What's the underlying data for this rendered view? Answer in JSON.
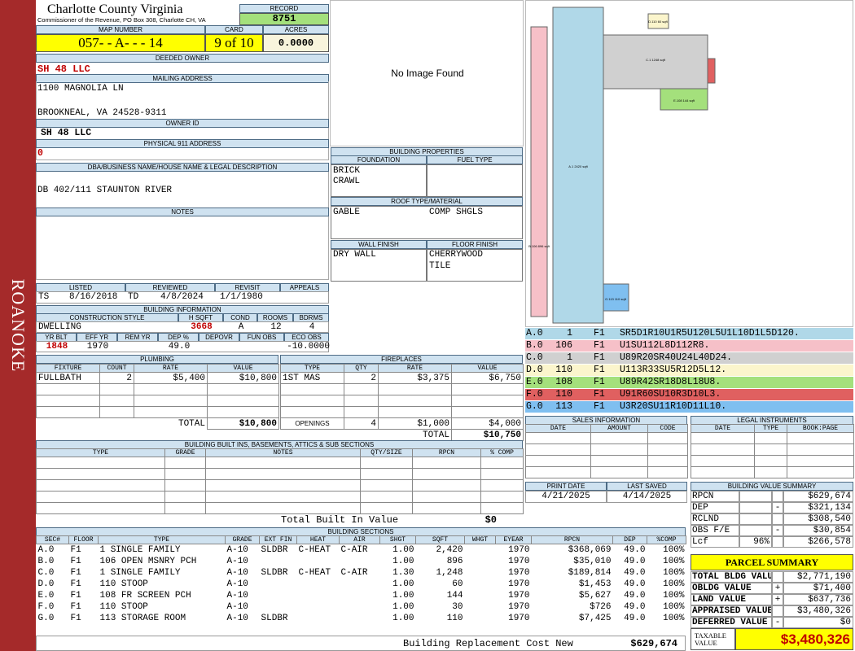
{
  "side_label": "ROANOKE",
  "header": {
    "county": "Charlotte County Virginia",
    "commissioner": "Commissioner of the Revenue, PO Box 308, Charlotte CH, VA",
    "record_label": "RECORD",
    "record": "8751",
    "map_number_label": "MAP NUMBER",
    "map_number": "057- - A- - - 14",
    "card_label": "CARD",
    "card": "9 of 10",
    "acres_label": "ACRES",
    "acres": "0.0000"
  },
  "owner": {
    "deeded_owner_label": "DEEDED OWNER",
    "deeded_owner": "SH 48 LLC",
    "mailing_label": "MAILING ADDRESS",
    "mailing_line1": "1100 MAGNOLIA LN",
    "mailing_line2": "BROOKNEAL, VA 24528-9311",
    "owner_id_label": "OWNER ID",
    "owner_id": "SH 48 LLC",
    "physical_label": "PHYSICAL 911 ADDRESS",
    "physical": "0",
    "dba_label": "DBA/BUSINESS NAME/HOUSE NAME & LEGAL DESCRIPTION",
    "dba": "DB 402/111 STAUNTON RIVER",
    "notes_label": "NOTES"
  },
  "image": {
    "no_image": "No Image Found"
  },
  "building_properties": {
    "title": "BUILDING PROPERTIES",
    "foundation_label": "FOUNDATION",
    "foundation": [
      "BRICK",
      "CRAWL"
    ],
    "fuel_label": "FUEL TYPE",
    "roof_label": "ROOF TYPE/MATERIAL",
    "roof_type": "GABLE",
    "roof_material": "COMP SHGLS",
    "wall_label": "WALL FINISH",
    "wall": "DRY WALL",
    "floor_label": "FLOOR FINISH",
    "floor": [
      "CHERRYWOOD",
      "TILE"
    ]
  },
  "dates": {
    "listed_label": "LISTED",
    "listed_by": "TS",
    "listed": "8/16/2018",
    "reviewed_label": "REVIEWED",
    "reviewed_by": "TD",
    "reviewed": "4/8/2024",
    "revisit_label": "REVISIT",
    "revisit": "1/1/1980",
    "appeals_label": "APPEALS"
  },
  "building_info": {
    "title": "BUILDING INFORMATION",
    "construction_label": "CONSTRUCTION STYLE",
    "construction": "DWELLING",
    "hsqft_label": "H SQFT",
    "hsqft": "3668",
    "cond_label": "COND",
    "cond": "A",
    "rooms_label": "ROOMS",
    "rooms": "12",
    "bdrms_label": "BDRMS",
    "bdrms": "4",
    "yrblt_label": "YR BLT",
    "yrblt": "1848",
    "effyr_label": "EFF YR",
    "effyr": "1970",
    "remyr_label": "REM YR",
    "remyr": "",
    "dep_label": "DEP %",
    "dep": "49.0",
    "depovr_label": "DEPOVR",
    "depovr": "",
    "funobs_label": "FUN OBS",
    "funobs": "",
    "ecoobs_label": "ECO OBS",
    "ecoobs": "-10.0000"
  },
  "plumbing": {
    "title": "PLUMBING",
    "headers": [
      "FIXTURE",
      "COUNT",
      "RATE",
      "VALUE"
    ],
    "rows": [
      [
        "FULLBATH",
        "2",
        "$5,400",
        "$10,800"
      ]
    ],
    "total_label": "TOTAL",
    "total": "$10,800"
  },
  "fireplaces": {
    "title": "FIREPLACES",
    "headers": [
      "TYPE",
      "QTY",
      "RATE",
      "VALUE"
    ],
    "rows": [
      [
        "1ST MAS",
        "2",
        "$3,375",
        "$6,750"
      ]
    ],
    "openings_label": "OPENINGS",
    "openings_qty": "4",
    "openings_rate": "$1,000",
    "openings_value": "$4,000",
    "total_label": "TOTAL",
    "total": "$10,750"
  },
  "built_ins": {
    "title": "BUILDING BUILT INS, BASEMENTS, ATTICS & SUB SECTIONS",
    "headers": [
      "TYPE",
      "GRADE",
      "NOTES",
      "QTY/SIZE",
      "RPCN",
      "% COMP"
    ],
    "total_label": "Total Built In Value",
    "total": "$0"
  },
  "sketch": {
    "labels": [
      {
        "id": "A",
        "text": "A.1\n2420 sqft"
      },
      {
        "id": "B",
        "text": "B.106\n896 sqft"
      },
      {
        "id": "C",
        "text": "C.1\n1248 sqft"
      },
      {
        "id": "D",
        "text": "D.110\n60 sqft"
      },
      {
        "id": "E",
        "text": "E.108\n144 sqft"
      },
      {
        "id": "G",
        "text": "G.113\n110 sqft"
      }
    ]
  },
  "sketch_codes": [
    {
      "sec": "A.0",
      "n": "1",
      "fl": "F1",
      "code": "SR5D1R10U1R5U120L5U1L10D1L5D120.",
      "color": "#b0d8e8"
    },
    {
      "sec": "B.0",
      "n": "106",
      "fl": "F1",
      "code": "U1SU112L8D112R8.",
      "color": "#f6c0c8"
    },
    {
      "sec": "C.0",
      "n": "1",
      "fl": "F1",
      "code": "U89R20SR40U24L40D24.",
      "color": "#d0d0d0"
    },
    {
      "sec": "D.0",
      "n": "110",
      "fl": "F1",
      "code": "U113R33SU5R12D5L12.",
      "color": "#fbf5cc"
    },
    {
      "sec": "E.0",
      "n": "108",
      "fl": "F1",
      "code": "U89R42SR18D8L18U8.",
      "color": "#a4e07c"
    },
    {
      "sec": "F.0",
      "n": "110",
      "fl": "F1",
      "code": "U91R60SU10R3D10L3.",
      "color": "#e06060"
    },
    {
      "sec": "G.0",
      "n": "113",
      "fl": "F1",
      "code": "U3R20SU11R10D11L10.",
      "color": "#7fbff0"
    }
  ],
  "sales": {
    "title": "SALES INFORMATION",
    "headers": [
      "DATE",
      "AMOUNT",
      "CODE"
    ]
  },
  "legal": {
    "title": "LEGAL INSTRUMENTS",
    "headers": [
      "DATE",
      "TYPE",
      "BOOK:PAGE"
    ]
  },
  "print": {
    "print_date_label": "PRINT DATE",
    "print_date": "4/21/2025",
    "last_saved_label": "LAST SAVED",
    "last_saved": "4/14/2025"
  },
  "value_summary": {
    "title": "BUILDING VALUE SUMMARY",
    "rows": [
      {
        "label": "RPCN",
        "sign": "",
        "pct": "",
        "value": "$629,674"
      },
      {
        "label": "DEP",
        "sign": "-",
        "pct": "",
        "value": "$321,134"
      },
      {
        "label": "RCLND",
        "sign": "",
        "pct": "",
        "value": "$308,540"
      },
      {
        "label": "OBS F/E",
        "sign": "-",
        "pct": "",
        "value": "$30,854"
      },
      {
        "label": "Lcf",
        "sign": "",
        "pct": "96%",
        "value": "$266,578"
      }
    ]
  },
  "parcel_summary": {
    "title": "PARCEL SUMMARY",
    "rows": [
      {
        "label": "TOTAL BLDG VALUE",
        "sign": "",
        "value": "$2,771,190"
      },
      {
        "label": "OBLDG VALUE",
        "sign": "+",
        "value": "$71,400"
      },
      {
        "label": "LAND VALUE",
        "sign": "+",
        "value": "$637,736"
      },
      {
        "label": "APPRAISED VALUE",
        "sign": "",
        "value": "$3,480,326"
      },
      {
        "label": "DEFERRED VALUE",
        "sign": "-",
        "value": "$0"
      }
    ],
    "taxable_label": "TAXABLE VALUE",
    "taxable": "$3,480,326"
  },
  "sections": {
    "title": "BUILDING SECTIONS",
    "headers": [
      "SEC#",
      "FLOOR",
      "TYPE",
      "GRADE",
      "EXT FIN",
      "HEAT",
      "AIR",
      "SHGT",
      "SQFT",
      "WHGT",
      "EYEAR",
      "RPCN",
      "DEP",
      "%COMP"
    ],
    "rows": [
      [
        "A.0",
        "F1",
        "1 SINGLE FAMILY",
        "A-10",
        "SLDBR",
        "C-HEAT",
        "C-AIR",
        "1.00",
        "2,420",
        "",
        "1970",
        "$368,069",
        "49.0",
        "100%"
      ],
      [
        "B.0",
        "F1",
        "106 OPEN MSNRY PCH",
        "A-10",
        "",
        "",
        "",
        "1.00",
        "896",
        "",
        "1970",
        "$35,010",
        "49.0",
        "100%"
      ],
      [
        "C.0",
        "F1",
        "1 SINGLE FAMILY",
        "A-10",
        "SLDBR",
        "C-HEAT",
        "C-AIR",
        "1.30",
        "1,248",
        "",
        "1970",
        "$189,814",
        "49.0",
        "100%"
      ],
      [
        "D.0",
        "F1",
        "110 STOOP",
        "A-10",
        "",
        "",
        "",
        "1.00",
        "60",
        "",
        "1970",
        "$1,453",
        "49.0",
        "100%"
      ],
      [
        "E.0",
        "F1",
        "108 FR SCREEN PCH",
        "A-10",
        "",
        "",
        "",
        "1.00",
        "144",
        "",
        "1970",
        "$5,627",
        "49.0",
        "100%"
      ],
      [
        "F.0",
        "F1",
        "110 STOOP",
        "A-10",
        "",
        "",
        "",
        "1.00",
        "30",
        "",
        "1970",
        "$726",
        "49.0",
        "100%"
      ],
      [
        "G.0",
        "F1",
        "113 STORAGE ROOM",
        "A-10",
        "SLDBR",
        "",
        "",
        "1.00",
        "110",
        "",
        "1970",
        "$7,425",
        "49.0",
        "100%"
      ]
    ],
    "rcn_label": "Building Replacement Cost New",
    "rcn": "$629,674"
  }
}
